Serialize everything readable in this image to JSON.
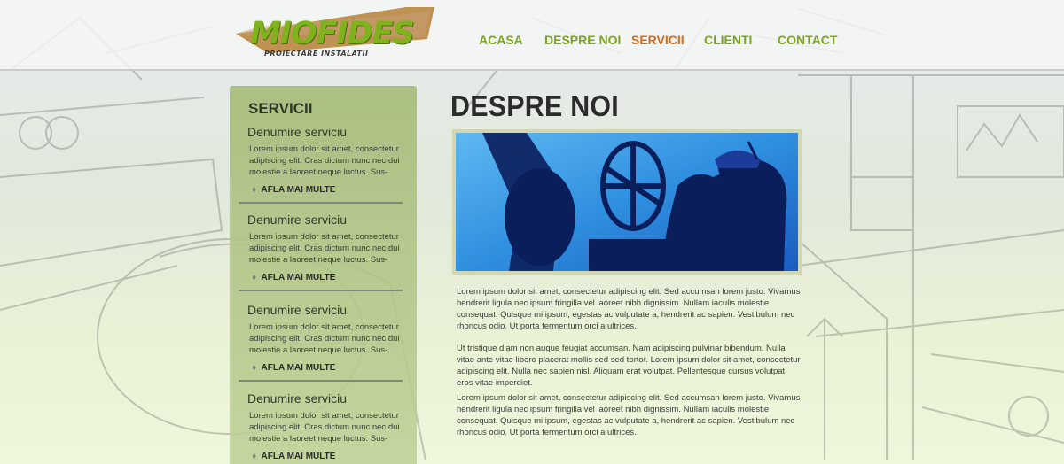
{
  "logo": {
    "name": "MIOFIDES",
    "tagline": "PROIECTARE INSTALATII"
  },
  "nav": {
    "items": [
      {
        "label": "ACASA"
      },
      {
        "label": "DESPRE NOI"
      },
      {
        "label": "SERVICII",
        "active": true
      },
      {
        "label": "CLIENTI"
      },
      {
        "label": "CONTACT"
      }
    ]
  },
  "colors": {
    "nav": "#7da41d",
    "nav_active": "#d46b17",
    "sidebar": "#a6bc7a",
    "logo_green": "#7fb21c"
  },
  "sidebar": {
    "title": "SERVICII",
    "services": [
      {
        "name": "Denumire serviciu",
        "desc": "Lorem ipsum dolor sit amet, consectetur adipiscing elit. Cras dictum nunc nec dui molestie a laoreet neque luctus. Sus-",
        "more": "AFLA MAI MULTE"
      },
      {
        "name": "Denumire serviciu",
        "desc": "Lorem ipsum dolor sit amet, consectetur adipiscing elit. Cras dictum nunc nec dui molestie a laoreet neque luctus. Sus-",
        "more": "AFLA MAI MULTE"
      },
      {
        "name": "Denumire serviciu",
        "desc": "Lorem ipsum dolor sit amet, consectetur adipiscing elit. Cras dictum nunc nec dui molestie a laoreet neque luctus. Sus-",
        "more": "AFLA MAI MULTE"
      },
      {
        "name": "Denumire serviciu",
        "desc": "Lorem ipsum dolor sit amet, consectetur adipiscing elit. Cras dictum nunc nec dui molestie a laoreet neque luctus. Sus-",
        "more": "AFLA MAI MULTE"
      }
    ]
  },
  "main": {
    "title": "DESPRE NOI",
    "paragraphs": [
      "Lorem ipsum dolor sit amet, consectetur adipiscing elit. Sed accumsan lorem justo. Vivamus hendrerit ligula nec ipsum fringilla vel laoreet nibh dignissim. Nullam iaculis molestie consequat. Quisque mi ipsum, egestas ac vulputate a, hendrerit ac sapien. Vestibulum nec rhoncus odio. Ut porta fermentum orci a ultrices.",
      "Ut tristique diam non augue feugiat accumsan. Nam adipiscing pulvinar bibendum. Nulla vitae ante vitae libero placerat mollis sed sed tortor. Lorem ipsum dolor sit amet, consectetur adipiscing elit. Nulla nec sapien nisl. Aliquam erat volutpat. Pellentesque cursus volutpat eros vitae imperdiet.",
      "Lorem ipsum dolor sit amet, consectetur adipiscing elit. Sed accumsan lorem justo. Vivamus hendrerit ligula nec ipsum fringilla vel laoreet nibh dignissim. Nullam iaculis molestie consequat. Quisque mi ipsum, egestas ac vulputate a, hendrerit ac sapien. Vestibulum nec rhoncus odio. Ut porta fermentum orci a ultrices."
    ]
  }
}
